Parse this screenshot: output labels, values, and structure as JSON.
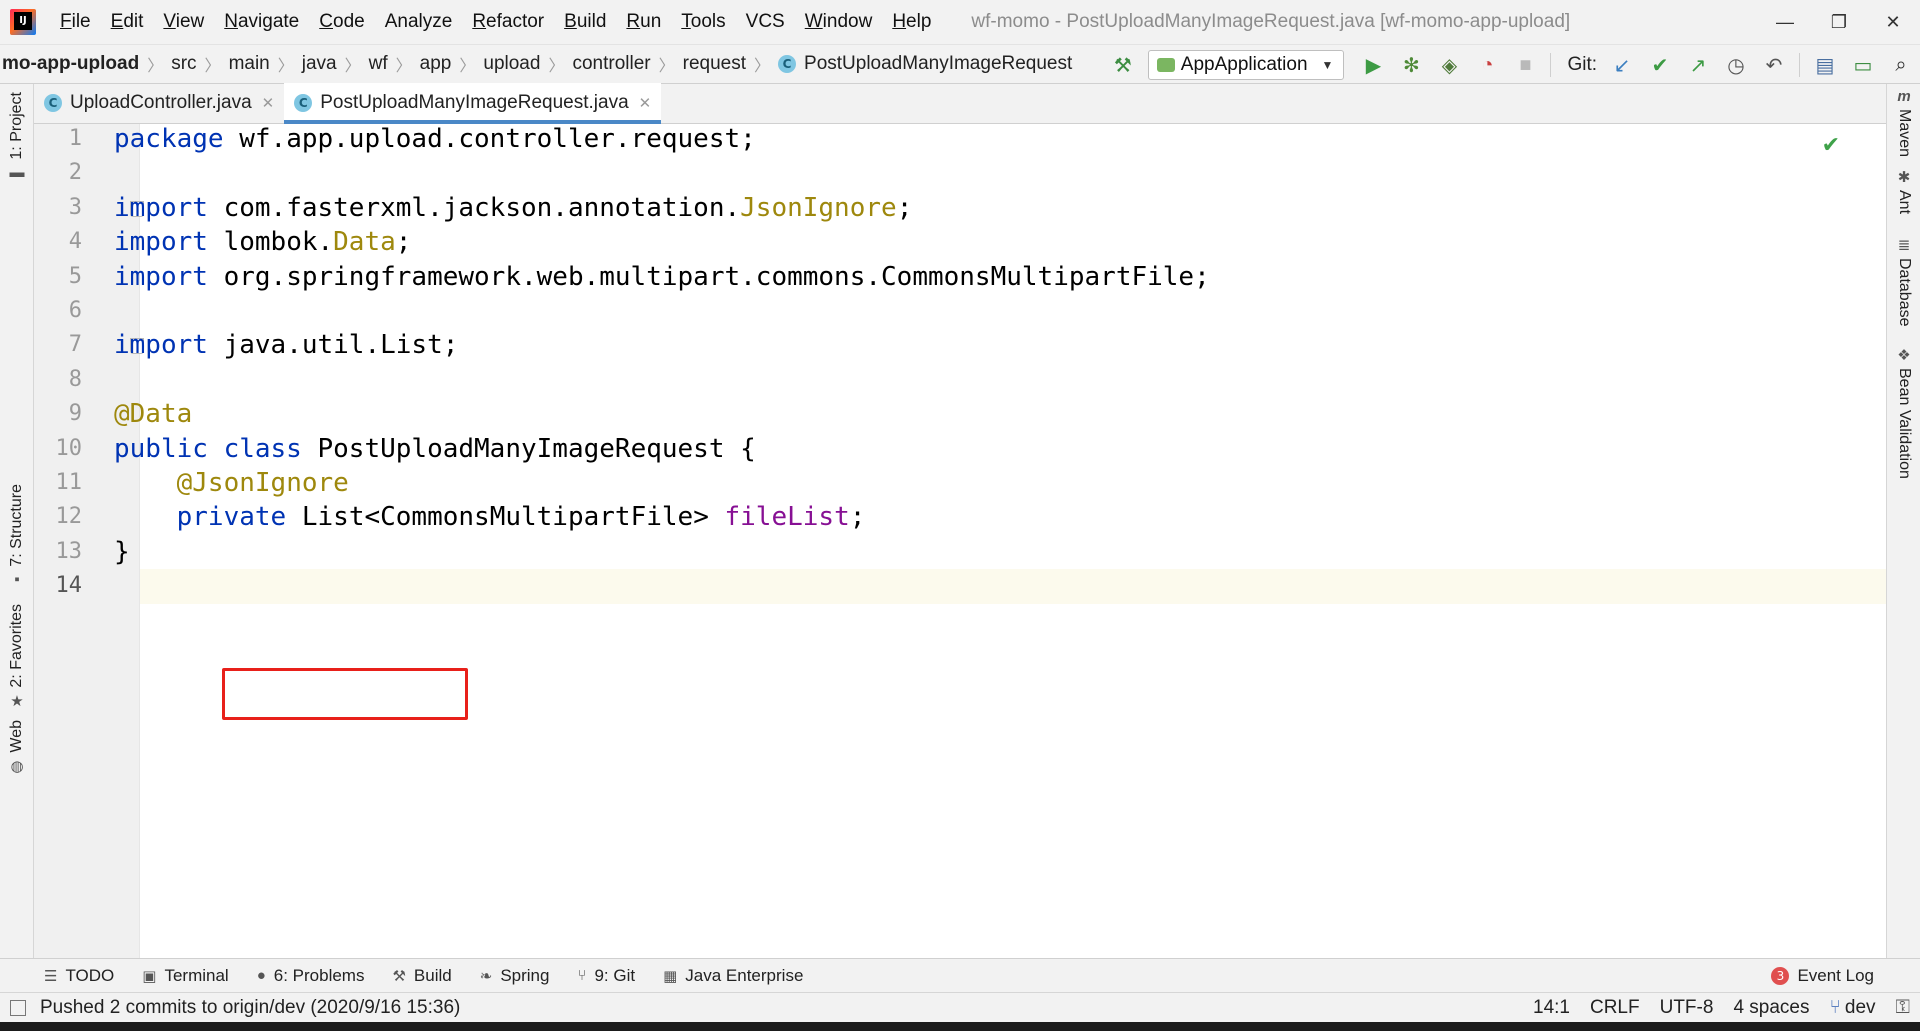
{
  "menu": {
    "items": [
      {
        "label": "File",
        "mnemonic": "F",
        "rest": "ile"
      },
      {
        "label": "Edit",
        "mnemonic": "E",
        "rest": "dit"
      },
      {
        "label": "View",
        "mnemonic": "V",
        "rest": "iew"
      },
      {
        "label": "Navigate",
        "mnemonic": "N",
        "rest": "avigate"
      },
      {
        "label": "Code",
        "mnemonic": "C",
        "rest": "ode"
      },
      {
        "label": "Analyze",
        "mnemonic": "",
        "rest": "Analyze"
      },
      {
        "label": "Refactor",
        "mnemonic": "R",
        "rest": "efactor"
      },
      {
        "label": "Build",
        "mnemonic": "B",
        "rest": "uild"
      },
      {
        "label": "Run",
        "mnemonic": "R",
        "rest": "un"
      },
      {
        "label": "Tools",
        "mnemonic": "T",
        "rest": "ools"
      },
      {
        "label": "VCS",
        "mnemonic": "",
        "rest": "VCS"
      },
      {
        "label": "Window",
        "mnemonic": "W",
        "rest": "indow"
      },
      {
        "label": "Help",
        "mnemonic": "H",
        "rest": "elp"
      }
    ]
  },
  "window_title": "wf-momo - PostUploadManyImageRequest.java [wf-momo-app-upload]",
  "breadcrumbs": [
    "mo-app-upload",
    "src",
    "main",
    "java",
    "wf",
    "app",
    "upload",
    "controller",
    "request",
    "PostUploadManyImageRequest"
  ],
  "toolbar": {
    "run_config": "AppApplication",
    "git_label": "Git:"
  },
  "tabs": [
    {
      "label": "UploadController.java",
      "active": false
    },
    {
      "label": "PostUploadManyImageRequest.java",
      "active": true
    }
  ],
  "left_tools": {
    "project": "1: Project",
    "structure": "7: Structure",
    "favorites": "2: Favorites",
    "web": "Web"
  },
  "right_tools": {
    "maven": "Maven",
    "ant": "Ant",
    "database": "Database",
    "bean_validation": "Bean Validation"
  },
  "editor": {
    "current_line": 14,
    "lines": [
      {
        "n": "1",
        "tokens": [
          {
            "t": "package",
            "c": "k"
          },
          {
            "t": " wf.app.upload.controller.request;",
            "c": ""
          }
        ]
      },
      {
        "n": "2",
        "tokens": []
      },
      {
        "n": "3",
        "tokens": [
          {
            "t": "import",
            "c": "k"
          },
          {
            "t": " com.fasterxml.jackson.annotation.",
            "c": ""
          },
          {
            "t": "JsonIgnore",
            "c": "a"
          },
          {
            "t": ";",
            "c": ""
          }
        ],
        "fold": true
      },
      {
        "n": "4",
        "tokens": [
          {
            "t": "import",
            "c": "k"
          },
          {
            "t": " lombok.",
            "c": ""
          },
          {
            "t": "Data",
            "c": "a"
          },
          {
            "t": ";",
            "c": ""
          }
        ]
      },
      {
        "n": "5",
        "tokens": [
          {
            "t": "import",
            "c": "k"
          },
          {
            "t": " org.springframework.web.multipart.commons.CommonsMultipartFile;",
            "c": ""
          }
        ]
      },
      {
        "n": "6",
        "tokens": []
      },
      {
        "n": "7",
        "tokens": [
          {
            "t": "import",
            "c": "k"
          },
          {
            "t": " java.util.List;",
            "c": ""
          }
        ],
        "fold": true
      },
      {
        "n": "8",
        "tokens": []
      },
      {
        "n": "9",
        "tokens": [
          {
            "t": "@Data",
            "c": "a"
          }
        ]
      },
      {
        "n": "10",
        "tokens": [
          {
            "t": "public class",
            "c": "k"
          },
          {
            "t": " PostUploadManyImageRequest {",
            "c": ""
          }
        ]
      },
      {
        "n": "11",
        "tokens": [
          {
            "t": "    ",
            "c": ""
          },
          {
            "t": "@JsonIgnore",
            "c": "a"
          }
        ]
      },
      {
        "n": "12",
        "tokens": [
          {
            "t": "    ",
            "c": ""
          },
          {
            "t": "private",
            "c": "k"
          },
          {
            "t": " List<CommonsMultipartFile> ",
            "c": ""
          },
          {
            "t": "fileList",
            "c": "f"
          },
          {
            "t": ";",
            "c": ""
          }
        ]
      },
      {
        "n": "13",
        "tokens": [
          {
            "t": "}",
            "c": ""
          }
        ]
      },
      {
        "n": "14",
        "tokens": []
      }
    ]
  },
  "bottom_tools": [
    {
      "label": "TODO",
      "icon": "list-icon",
      "glyph": "☰"
    },
    {
      "label": "Terminal",
      "icon": "terminal-icon",
      "glyph": "▣"
    },
    {
      "label": "6: Problems",
      "icon": "problems-icon",
      "glyph": "●"
    },
    {
      "label": "Build",
      "icon": "hammer-icon",
      "glyph": "⚒"
    },
    {
      "label": "Spring",
      "icon": "spring-icon",
      "glyph": "❧"
    },
    {
      "label": "9: Git",
      "icon": "git-branch-icon",
      "glyph": "⑂"
    },
    {
      "label": "Java Enterprise",
      "icon": "java-enterprise-icon",
      "glyph": "▦"
    }
  ],
  "event_log": {
    "label": "Event Log",
    "count": "3"
  },
  "status": {
    "message": "Pushed 2 commits to origin/dev (2020/9/16 15:36)",
    "position": "14:1",
    "line_ending": "CRLF",
    "encoding": "UTF-8",
    "indent": "4 spaces",
    "branch": "dev"
  },
  "colors": {
    "keyword": "#0033b3",
    "annotation": "#9e880d",
    "field": "#871094",
    "highlight_box": "#e8201a",
    "active_tab_underline": "#4a88c7"
  }
}
